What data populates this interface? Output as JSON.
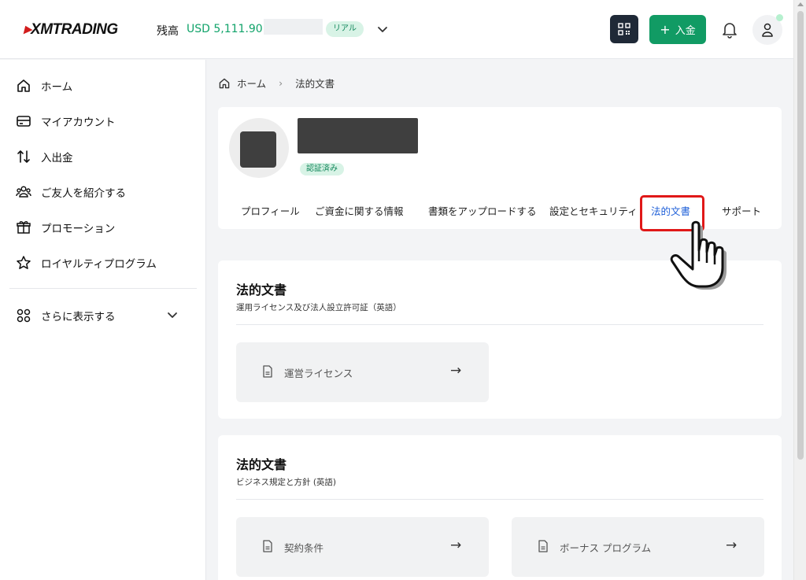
{
  "header": {
    "logo_text": "XMTRADING",
    "balance_label": "残高",
    "balance_value": "USD 5,111.90",
    "account_type_badge": "リアル",
    "deposit_label": "入金",
    "icons": [
      "qr-code-icon",
      "plus-icon",
      "bell-icon",
      "user-icon",
      "chevron-down-icon"
    ],
    "colors": {
      "brand_red": "#d21c1c",
      "accent_green": "#119b64",
      "link_blue": "#1e5fd8"
    }
  },
  "sidebar": {
    "items": [
      {
        "label": "ホーム",
        "icon": "home-icon"
      },
      {
        "label": "マイアカウント",
        "icon": "credit-card-icon"
      },
      {
        "label": "入出金",
        "icon": "transfer-arrows-icon"
      },
      {
        "label": "ご友人を紹介する",
        "icon": "users-icon"
      },
      {
        "label": "プロモーション",
        "icon": "gift-icon"
      },
      {
        "label": "ロイヤルティプログラム",
        "icon": "star-icon"
      }
    ],
    "more": {
      "label": "さらに表示する",
      "icon": "grid-icon"
    }
  },
  "breadcrumb": {
    "home": "ホーム",
    "current": "法的文書"
  },
  "profile": {
    "verified_badge": "認証済み",
    "tabs": [
      {
        "label": "プロフィール"
      },
      {
        "label": "ご資金に関する情報"
      },
      {
        "label": "書類をアップロードする"
      },
      {
        "label": "設定とセキュリティ"
      },
      {
        "label": "法的文書"
      },
      {
        "label": "サポート"
      }
    ],
    "active_tab": "法的文書"
  },
  "sections": [
    {
      "title": "法的文書",
      "subtitle": "運用ライセンス及び法人設立許可証（英語）",
      "items": [
        {
          "label": "運営ライセンス"
        }
      ]
    },
    {
      "title": "法的文書",
      "subtitle": "ビジネス規定と方針 (英語)",
      "items": [
        {
          "label": "契約条件"
        },
        {
          "label": "ボーナス プログラム"
        }
      ]
    }
  ],
  "doc_arrow": "→"
}
